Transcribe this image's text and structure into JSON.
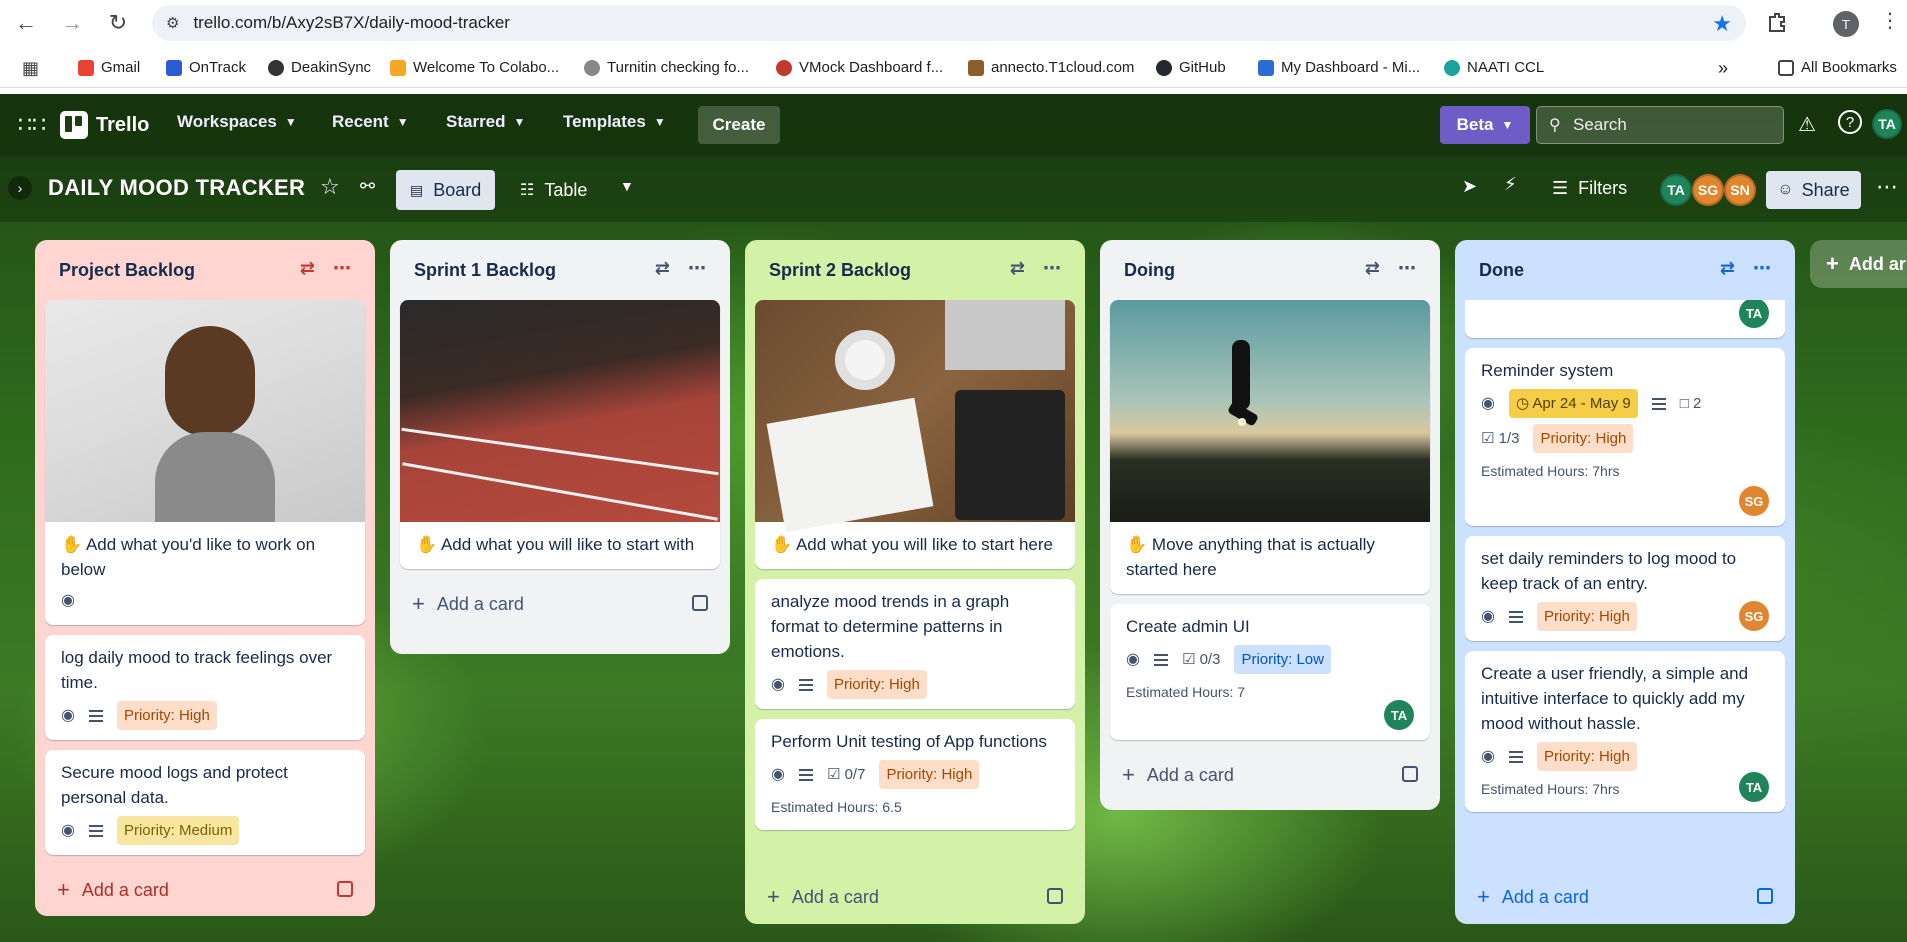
{
  "browser": {
    "url": "trello.com/b/Axy2sB7X/daily-mood-tracker",
    "profile_initial": "T",
    "bookmarks": [
      "Gmail",
      "OnTrack",
      "DeakinSync",
      "Welcome To Colabo...",
      "Turnitin checking fo...",
      "VMock Dashboard f...",
      "annecto.T1cloud.com",
      "GitHub",
      "My Dashboard - Mi...",
      "NAATI CCL"
    ],
    "all_bookmarks": "All Bookmarks",
    "more": "»"
  },
  "topbar": {
    "logo": "Trello",
    "workspaces": "Workspaces",
    "recent": "Recent",
    "starred": "Starred",
    "templates": "Templates",
    "create": "Create",
    "beta": "Beta",
    "search_placeholder": "Search",
    "user_initials": "TA"
  },
  "board": {
    "title": "DAILY MOOD TRACKER",
    "view_board": "Board",
    "view_table": "Table",
    "filters": "Filters",
    "share": "Share",
    "members": [
      "TA",
      "SG",
      "SN"
    ]
  },
  "lists": [
    {
      "title": "Project Backlog",
      "cover_card": "Add what you'd like to work on below",
      "cards": [
        {
          "title": "log daily mood to track feelings over time.",
          "label": "Priority: High"
        },
        {
          "title": "Secure mood logs and protect personal data.",
          "label": "Priority: Medium"
        }
      ],
      "add": "Add a card"
    },
    {
      "title": "Sprint 1 Backlog",
      "cover_card": "Add what you will like to start with",
      "add": "Add a card"
    },
    {
      "title": "Sprint 2 Backlog",
      "cover_card": "Add what you will like to start here",
      "cards": [
        {
          "title": "analyze mood trends in a graph format to determine patterns in emotions.",
          "label": "Priority: High"
        },
        {
          "title": "Perform Unit testing of App functions",
          "checklist": "0/7",
          "label": "Priority: High",
          "estimate": "Estimated Hours: 6.5"
        }
      ],
      "add": "Add a card"
    },
    {
      "title": "Doing",
      "cover_card": "Move anything that is actually started here",
      "cards": [
        {
          "title": "Create admin UI",
          "checklist": "0/3",
          "label": "Priority: Low",
          "estimate": "Estimated Hours: 7",
          "member": "TA"
        }
      ],
      "add": "Add a card"
    },
    {
      "title": "Done",
      "cards": [
        {
          "member": "TA"
        },
        {
          "title": "Reminder system",
          "date": "Apr 24 - May 9",
          "comments": "2",
          "checklist": "1/3",
          "label": "Priority: High",
          "estimate": "Estimated Hours: 7hrs",
          "member": "SG"
        },
        {
          "title": "set daily reminders to log mood to keep track of an entry.",
          "label": "Priority: High",
          "member": "SG"
        },
        {
          "title": "Create a user friendly, a simple and intuitive interface to quickly add my mood without hassle.",
          "label": "Priority: High",
          "estimate": "Estimated Hours: 7hrs",
          "member": "TA"
        }
      ],
      "add": "Add a card"
    }
  ],
  "add_another_list": "Add ar",
  "colors": {
    "project_backlog": "#ffd5d2",
    "sprint1": "#f1f2f4",
    "sprint2": "#d3f1a7",
    "doing": "#f1f2f4",
    "done": "#cce0ff",
    "avatar_ta": "#1f845a",
    "avatar_sg": "#e2852f",
    "avatar_sn": "#e2852f"
  }
}
